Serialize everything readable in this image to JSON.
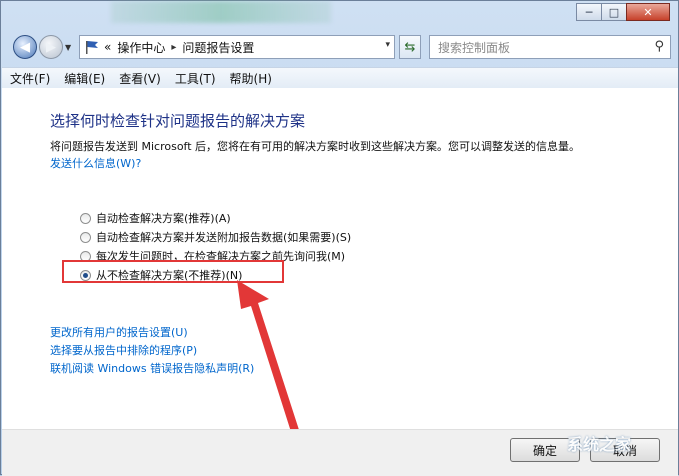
{
  "window": {
    "controls": {
      "minimize": "─",
      "maximize": "□",
      "close": "✕"
    }
  },
  "address": {
    "overflow": "«",
    "crumbs": [
      "操作中心",
      "问题报告设置"
    ],
    "separator": "▸",
    "dropdown": "▾"
  },
  "search": {
    "placeholder": "搜索控制面板"
  },
  "menu": [
    "文件(F)",
    "编辑(E)",
    "查看(V)",
    "工具(T)",
    "帮助(H)"
  ],
  "main": {
    "title": "选择何时检查针对问题报告的解决方案",
    "description": "将问题报告发送到 Microsoft 后，您将在有可用的解决方案时收到这些解决方案。您可以调整发送的信息量。",
    "info_link": "发送什么信息(W)?",
    "options": [
      {
        "label": "自动检查解决方案(推荐)(A)",
        "selected": false
      },
      {
        "label": "自动检查解决方案并发送附加报告数据(如果需要)(S)",
        "selected": false
      },
      {
        "label": "每次发生问题时，在检查解决方案之前先询问我(M)",
        "selected": false
      },
      {
        "label": "从不检查解决方案(不推荐)(N)",
        "selected": true
      }
    ],
    "links": [
      "更改所有用户的报告设置(U)",
      "选择要从报告中排除的程序(P)",
      "联机阅读 Windows 错误报告隐私声明(R)"
    ]
  },
  "footer": {
    "ok": "确定",
    "cancel": "取消"
  },
  "watermark": "系统之家",
  "colors": {
    "highlight": "#e23737",
    "link": "#0066cc",
    "title": "#1e3287"
  }
}
